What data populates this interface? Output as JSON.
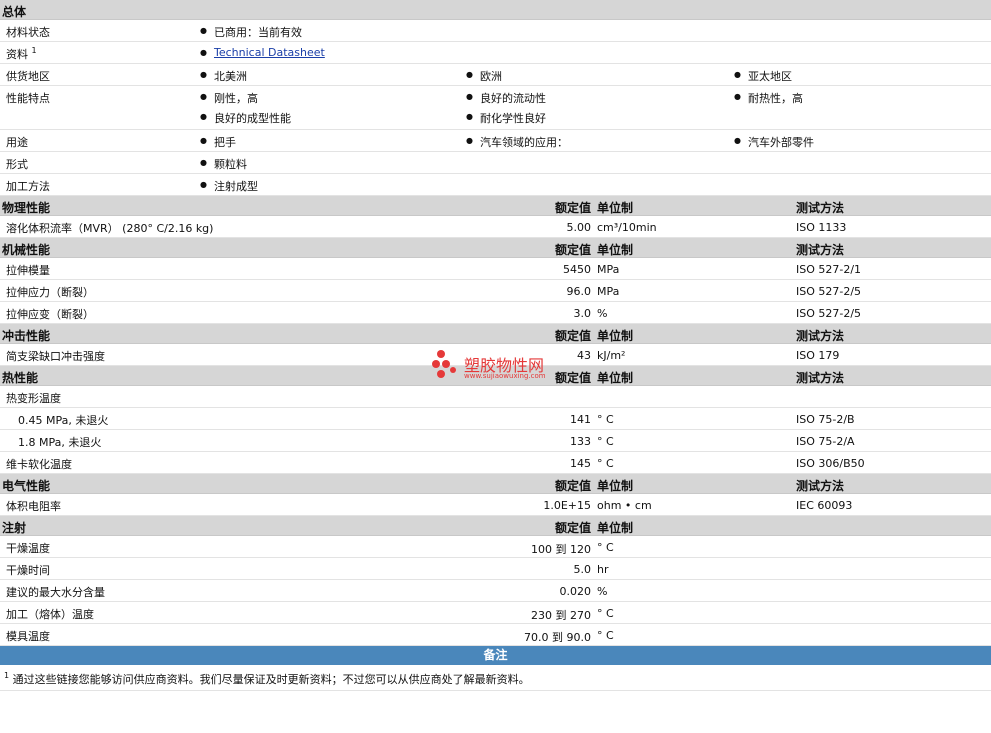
{
  "general": {
    "title": "总体",
    "material_status": {
      "label": "材料状态",
      "value": "已商用：当前有效"
    },
    "docs": {
      "label": "资料",
      "sup": "1",
      "link": "Technical Datasheet"
    },
    "region": {
      "label": "供货地区",
      "values": [
        "北美洲",
        "欧洲",
        "亚太地区"
      ]
    },
    "features": {
      "label": "性能特点",
      "values": [
        "刚性，高",
        "良好的流动性",
        "耐热性，高",
        "良好的成型性能",
        "耐化学性良好"
      ]
    },
    "uses": {
      "label": "用途",
      "values": [
        "把手",
        "汽车领域的应用：",
        "汽车外部零件"
      ]
    },
    "form": {
      "label": "形式",
      "value": "颗粒料"
    },
    "processing": {
      "label": "加工方法",
      "value": "注射成型"
    }
  },
  "columns": {
    "value": "额定值",
    "unit": "单位制",
    "test": "测试方法"
  },
  "physical": {
    "title": "物理性能",
    "rows": [
      {
        "label": "溶化体积流率（MVR） (280° C/2.16 kg)",
        "value": "5.00",
        "unit": "cm³/10min",
        "method": "ISO 1133"
      }
    ]
  },
  "mechanical": {
    "title": "机械性能",
    "rows": [
      {
        "label": "拉伸模量",
        "value": "5450",
        "unit": "MPa",
        "method": "ISO 527-2/1"
      },
      {
        "label": "拉伸应力（断裂）",
        "value": "96.0",
        "unit": "MPa",
        "method": "ISO 527-2/5"
      },
      {
        "label": "拉伸应变（断裂）",
        "value": "3.0",
        "unit": "%",
        "method": "ISO 527-2/5"
      }
    ]
  },
  "impact": {
    "title": "冲击性能",
    "rows": [
      {
        "label": "简支梁缺口冲击强度",
        "value": "43",
        "unit": "kJ/m²",
        "method": "ISO 179"
      }
    ]
  },
  "thermal": {
    "title": "热性能",
    "hdt_label": "热变形温度",
    "rows": [
      {
        "label": "0.45 MPa, 未退火",
        "value": "141",
        "unit": "° C",
        "method": "ISO 75-2/B"
      },
      {
        "label": "1.8 MPa, 未退火",
        "value": "133",
        "unit": "° C",
        "method": "ISO 75-2/A"
      },
      {
        "label": "维卡软化温度",
        "value": "145",
        "unit": "° C",
        "method": "ISO 306/B50"
      }
    ]
  },
  "electrical": {
    "title": "电气性能",
    "rows": [
      {
        "label": "体积电阻率",
        "value": "1.0E+15",
        "unit": "ohm • cm",
        "method": "IEC 60093"
      }
    ]
  },
  "injection": {
    "title": "注射",
    "rows": [
      {
        "label": "干燥温度",
        "value": "100 到 120",
        "unit": "° C"
      },
      {
        "label": "干燥时间",
        "value": "5.0",
        "unit": "hr"
      },
      {
        "label": "建议的最大水分含量",
        "value": "0.020",
        "unit": "%"
      },
      {
        "label": "加工（熔体）温度",
        "value": "230 到 270",
        "unit": "° C"
      },
      {
        "label": "模具温度",
        "value": "70.0 到 90.0",
        "unit": "° C"
      }
    ]
  },
  "notes": {
    "title": "备注",
    "sup": "1",
    "text": "通过这些链接您能够访问供应商资料。我们尽量保证及时更新资料；不过您可以从供应商处了解最新资料。"
  },
  "watermark": {
    "name": "塑胶物性网",
    "url": "www.sujiaowuxing.com",
    "color": "#e53939"
  }
}
